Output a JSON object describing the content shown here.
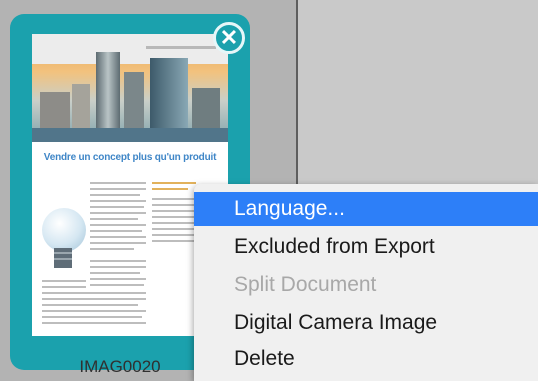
{
  "thumbnail": {
    "label": "IMAG0020",
    "headline": "Vendre un concept plus qu'un produit"
  },
  "context_menu": {
    "items": [
      {
        "label": "Language...",
        "state": "highlighted"
      },
      {
        "label": "Excluded from Export",
        "state": "enabled"
      },
      {
        "label": "Split Document",
        "state": "disabled"
      },
      {
        "label": "Digital Camera Image",
        "state": "enabled"
      },
      {
        "label": "Delete",
        "state": "enabled"
      }
    ]
  },
  "colors": {
    "card": "#1ba1ad",
    "highlight": "#2d7ff8",
    "headline": "#3f86c7"
  },
  "icons": {
    "close": "close-circle-icon",
    "bulb": "lightbulb-icon"
  }
}
